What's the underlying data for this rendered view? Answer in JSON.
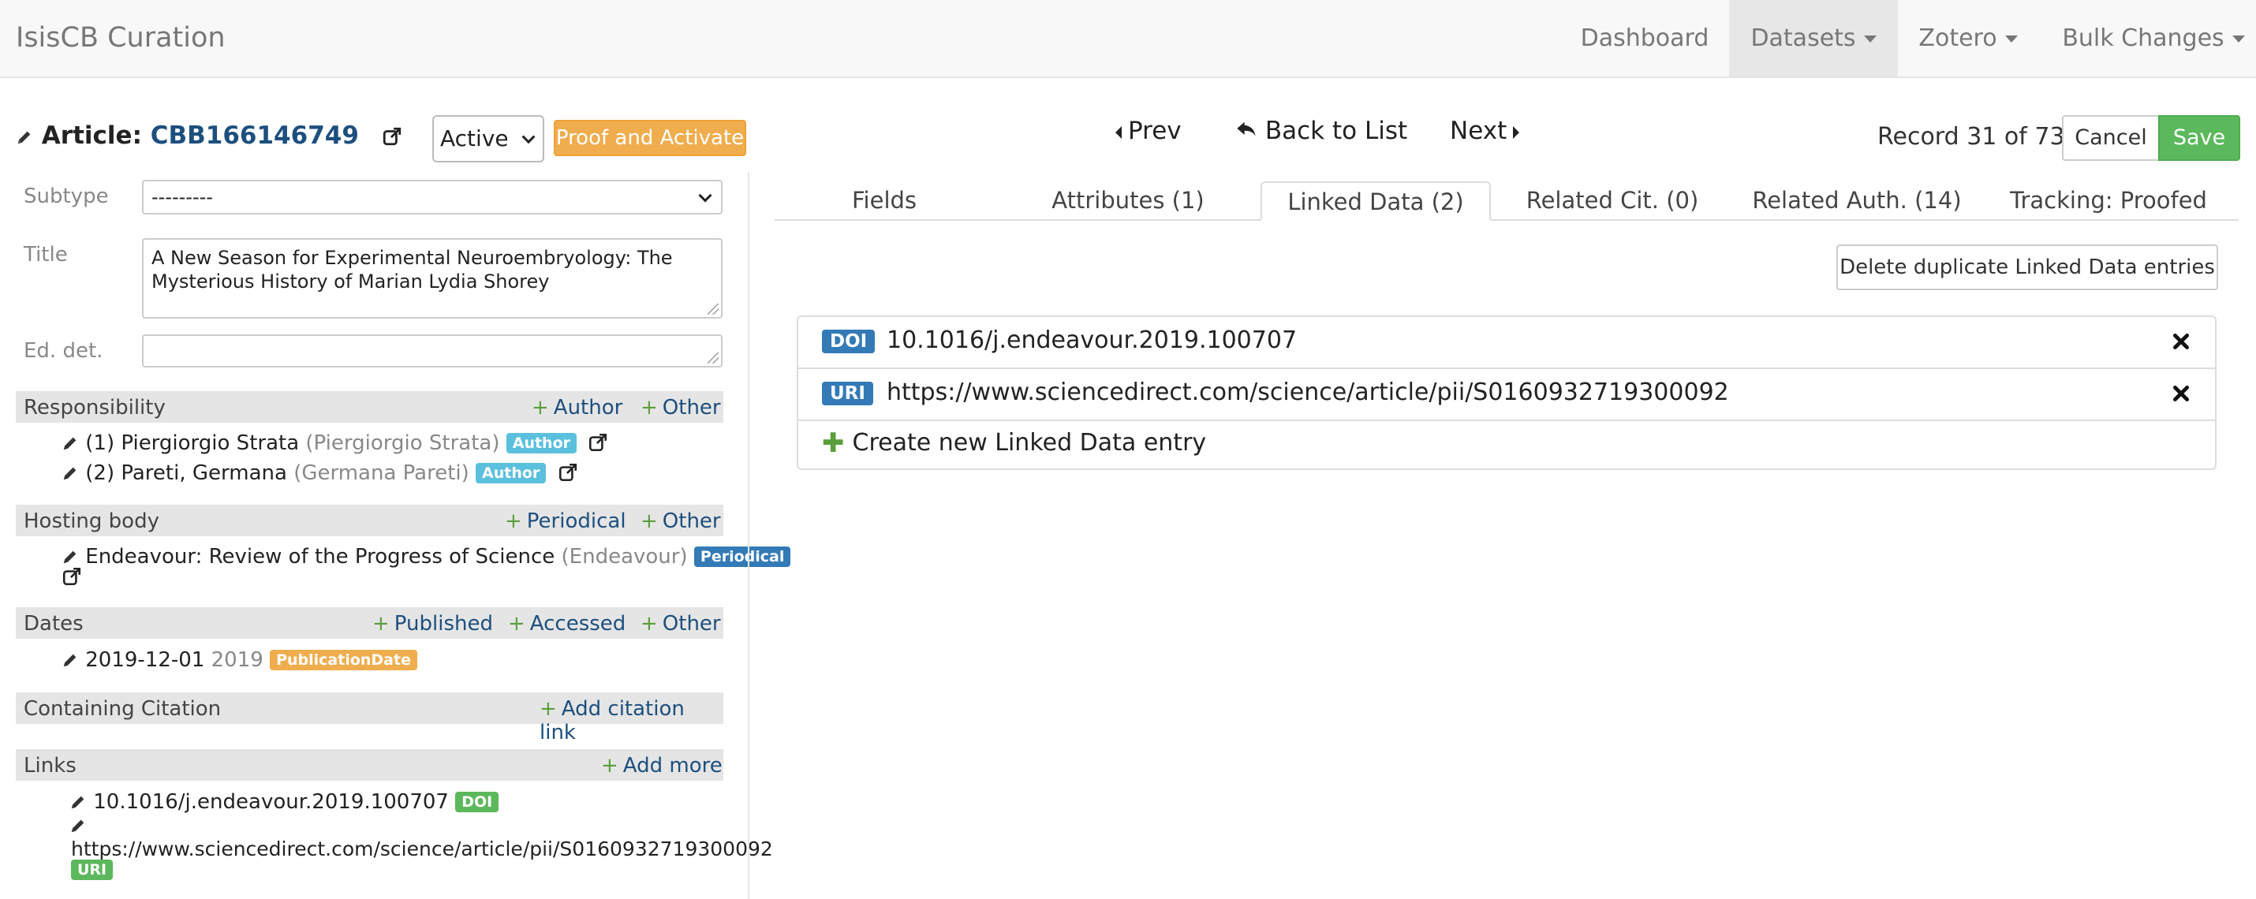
{
  "navbar": {
    "brand": "IsisCB Curation",
    "items": [
      {
        "label": "Dashboard",
        "dropdown": false
      },
      {
        "label": "Datasets",
        "dropdown": true,
        "active": true
      },
      {
        "label": "Zotero",
        "dropdown": true
      },
      {
        "label": "Bulk Changes",
        "dropdown": true
      }
    ]
  },
  "record": {
    "type_label": "Article",
    "id": "CBB166146749",
    "status": "Active",
    "proof_button": "Proof and Activate"
  },
  "pager": {
    "prev": "Prev",
    "back": "Back to List",
    "next": "Next",
    "record_count": "Record 31 of 73",
    "cancel": "Cancel",
    "save": "Save"
  },
  "form": {
    "subtype_label": "Subtype",
    "subtype_value": "---------",
    "title_label": "Title",
    "title_value": "A New Season for Experimental Neuroembryology: The Mysterious History of Marian Lydia Shorey",
    "eddet_label": "Ed. det.",
    "eddet_value": ""
  },
  "responsibility": {
    "title": "Responsibility",
    "actions": [
      "Author",
      "Other"
    ],
    "entries": [
      {
        "name": "(1) Piergiorgio Strata",
        "alias": "(Piergiorgio Strata)",
        "badge": "Author"
      },
      {
        "name": "(2) Pareti, Germana",
        "alias": "(Germana Pareti)",
        "badge": "Author"
      }
    ]
  },
  "hosting": {
    "title": "Hosting body",
    "actions": [
      "Periodical",
      "Other"
    ],
    "entries": [
      {
        "name": "Endeavour: Review of the Progress of Science",
        "alias": "(Endeavour)",
        "badge": "Periodical"
      }
    ]
  },
  "dates": {
    "title": "Dates",
    "actions": [
      "Published",
      "Accessed",
      "Other"
    ],
    "entries": [
      {
        "date": "2019-12-01",
        "year": "2019",
        "badge": "PublicationDate"
      }
    ]
  },
  "containing": {
    "title": "Containing Citation",
    "action": "Add citation link"
  },
  "links": {
    "title": "Links",
    "action": "Add more",
    "entries": [
      {
        "value": "10.1016/j.endeavour.2019.100707",
        "badge": "DOI"
      },
      {
        "value": "https://www.sciencedirect.com/science/article/pii/S0160932719300092",
        "badge": "URI"
      }
    ]
  },
  "tabs": [
    {
      "label": "Fields"
    },
    {
      "label": "Attributes (1)"
    },
    {
      "label": "Linked Data (2)",
      "active": true
    },
    {
      "label": "Related Cit. (0)"
    },
    {
      "label": "Related Auth. (14)"
    },
    {
      "label": "Tracking: Proofed"
    }
  ],
  "linked_data": {
    "delete_button": "Delete duplicate Linked Data entries",
    "entries": [
      {
        "type": "DOI",
        "value": "10.1016/j.endeavour.2019.100707"
      },
      {
        "type": "URI",
        "value": "https://www.sciencedirect.com/science/article/pii/S0160932719300092"
      }
    ],
    "create_label": "Create new Linked Data entry"
  },
  "colors": {
    "link": "#1d4f7e",
    "warning": "#f0ad4e",
    "success": "#5cb85c",
    "primary": "#337ab7",
    "info": "#5bc0de"
  }
}
